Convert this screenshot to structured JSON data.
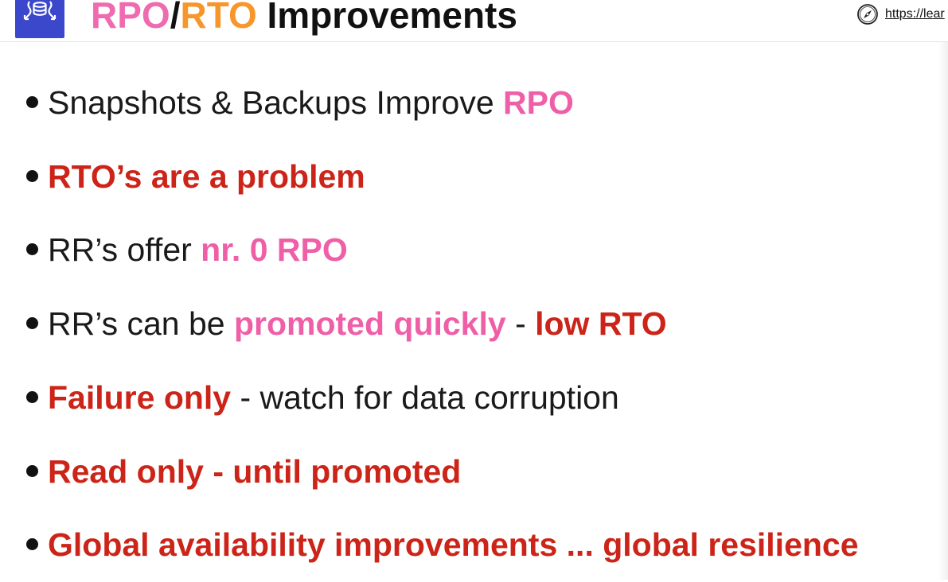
{
  "header": {
    "title_parts": [
      "RPO",
      "/",
      "RTO",
      " Improvements"
    ],
    "url_text": "https://lear",
    "logo_icon": "rds-database-icon",
    "compass_icon": "compass-icon"
  },
  "colors": {
    "pink": "#ef5fa8",
    "orange": "#f7962a",
    "red": "#cc2418",
    "logo_blue": "#3b48cc"
  },
  "bullets": [
    {
      "segments": [
        {
          "text": "Snapshots & Backups Improve ",
          "style": "normal"
        },
        {
          "text": "RPO",
          "style": "pink"
        }
      ]
    },
    {
      "segments": [
        {
          "text": "RTO’s are a problem",
          "style": "red"
        }
      ]
    },
    {
      "segments": [
        {
          "text": "RR’s offer ",
          "style": "normal"
        },
        {
          "text": "nr. 0 RPO",
          "style": "pink"
        }
      ]
    },
    {
      "segments": [
        {
          "text": "RR’s can be ",
          "style": "normal"
        },
        {
          "text": "promoted quickly",
          "style": "pink"
        },
        {
          "text": " - ",
          "style": "normal"
        },
        {
          "text": "low RTO",
          "style": "red"
        }
      ]
    },
    {
      "segments": [
        {
          "text": "Failure only",
          "style": "red"
        },
        {
          "text": " - watch for data corruption",
          "style": "normal"
        }
      ]
    },
    {
      "segments": [
        {
          "text": "Read only - until promoted",
          "style": "red"
        }
      ]
    },
    {
      "segments": [
        {
          "text": "Global availability improvements ... global resilience",
          "style": "red"
        }
      ]
    }
  ]
}
